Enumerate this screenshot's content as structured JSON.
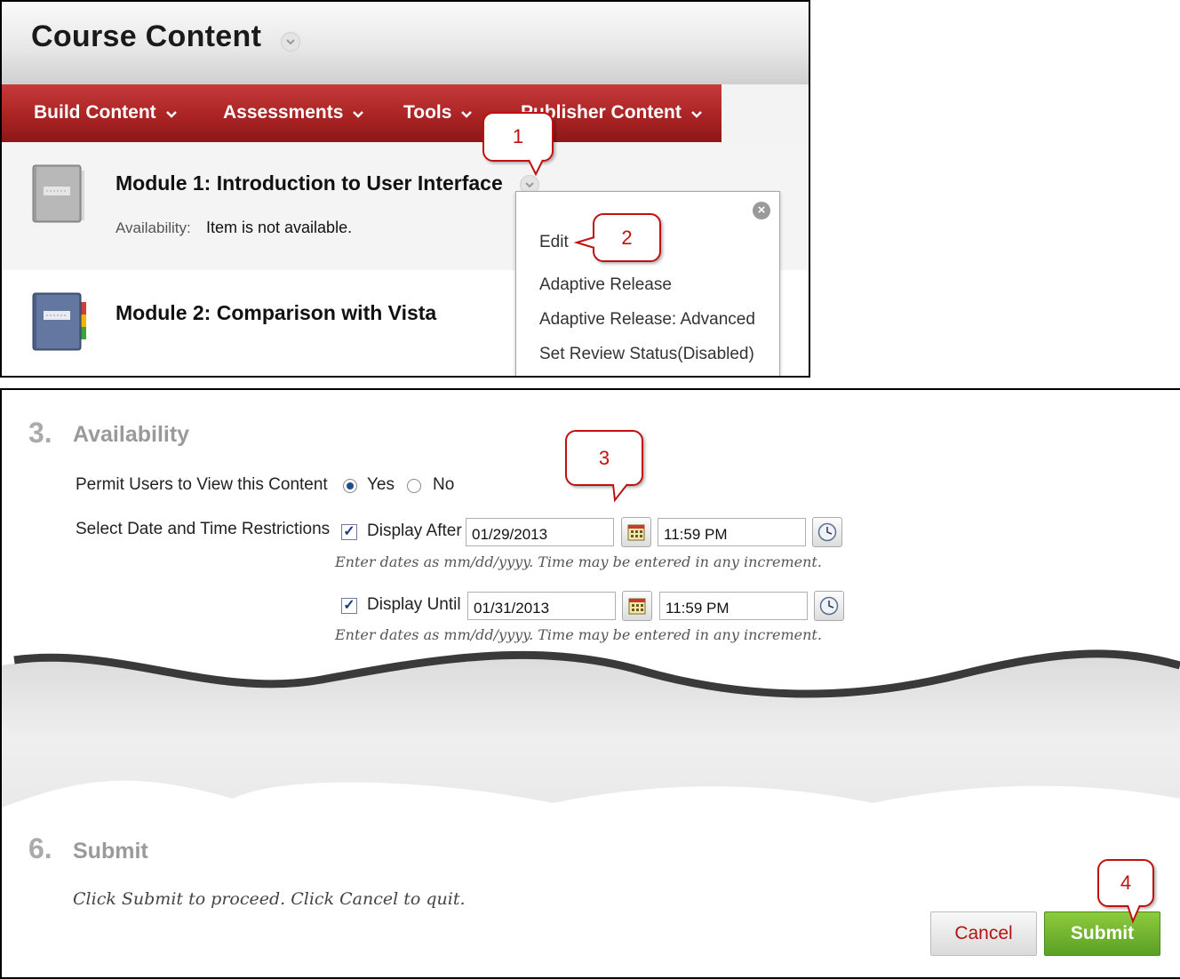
{
  "header": {
    "title": "Course Content"
  },
  "action_bar": {
    "items": [
      {
        "label": "Build Content"
      },
      {
        "label": "Assessments"
      },
      {
        "label": "Tools"
      },
      {
        "label": "Publisher Content"
      }
    ]
  },
  "modules": [
    {
      "title": "Module 1: Introduction to User Interface",
      "availability_label": "Availability:",
      "availability_value": "Item is not available."
    },
    {
      "title": "Module 2: Comparison with Vista"
    }
  ],
  "context_menu": {
    "items": [
      {
        "label": "Edit"
      },
      {
        "label": "Adaptive Release"
      },
      {
        "label": "Adaptive Release: Advanced"
      },
      {
        "label": "Set Review Status(Disabled)"
      }
    ]
  },
  "callouts": [
    "1",
    "2",
    "3",
    "4"
  ],
  "availability_section": {
    "number": "3.",
    "heading": "Availability",
    "permit_label": "Permit Users to View this Content",
    "yes_label": "Yes",
    "no_label": "No",
    "permit_selected": "Yes",
    "restrictions_label": "Select Date and Time Restrictions",
    "display_after": {
      "checked": true,
      "label": "Display After",
      "date": "01/29/2013",
      "time": "11:59 PM"
    },
    "display_until": {
      "checked": true,
      "label": "Display Until",
      "date": "01/31/2013",
      "time": "11:59 PM"
    },
    "hint": "Enter dates as mm/dd/yyyy. Time may be entered in any increment."
  },
  "submit_section": {
    "number": "6.",
    "heading": "Submit",
    "instruction": "Click Submit to proceed. Click Cancel to quit.",
    "cancel_label": "Cancel",
    "submit_label": "Submit"
  },
  "colors": {
    "action_bar": "#a82222",
    "callout_border": "#c01010",
    "submit_green": "#5aa024",
    "cancel_text": "#b31414"
  }
}
